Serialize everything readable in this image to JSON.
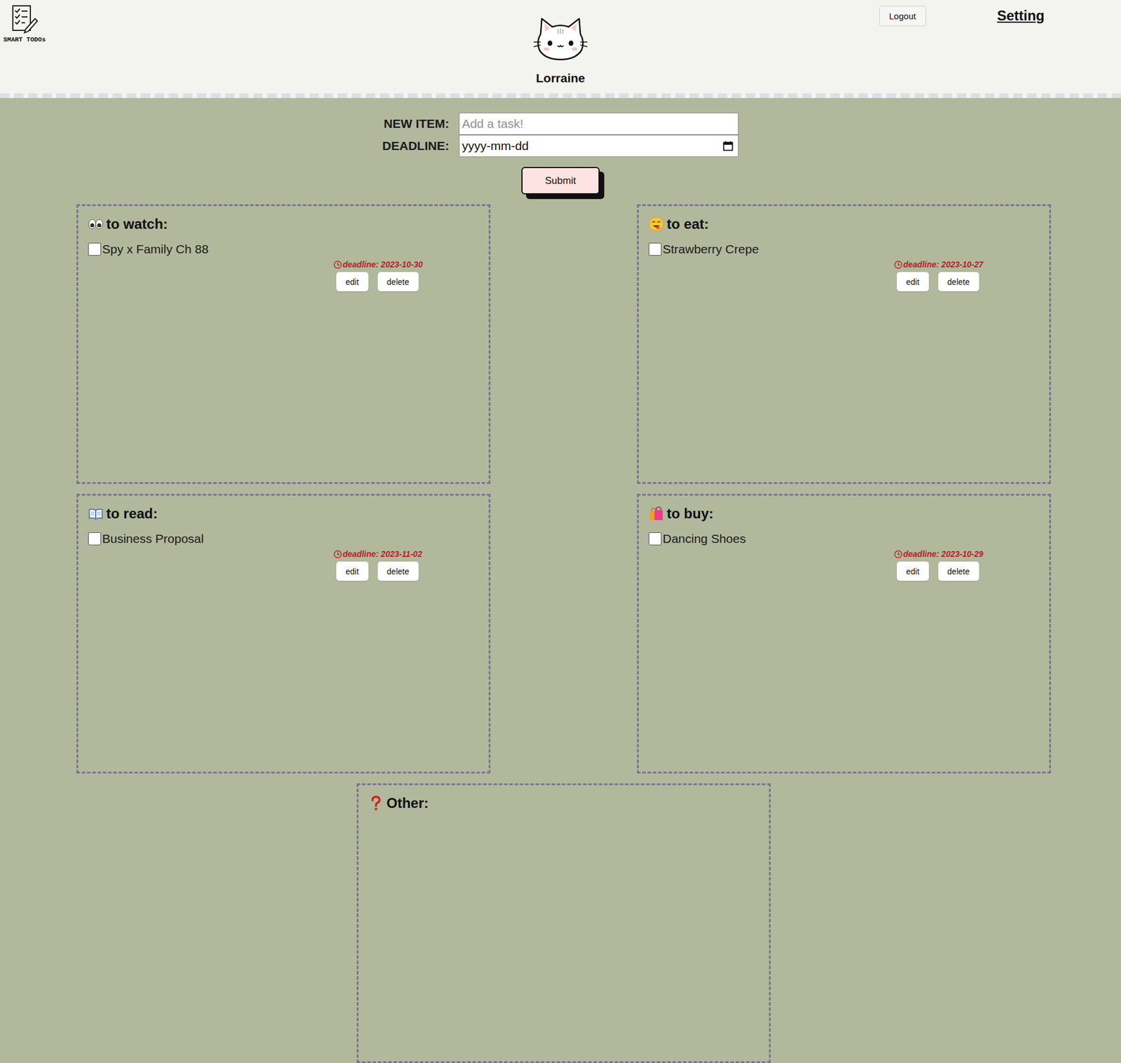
{
  "logo": {
    "text": "SMART TODOs"
  },
  "user": {
    "name": "Lorraine"
  },
  "header": {
    "logout": "Logout",
    "setting": "Setting"
  },
  "form": {
    "item_label": "NEW ITEM:",
    "item_placeholder": "Add a task!",
    "deadline_label": "DEADLINE:",
    "deadline_placeholder": "yyyy-mm-dd",
    "submit": "Submit"
  },
  "lists": [
    {
      "kind": "watch",
      "title": "to watch:",
      "items": [
        {
          "text": "Spy x Family Ch 88",
          "checked": false,
          "deadline": "deadline: 2023-10-30",
          "edit": "edit",
          "delete": "delete"
        }
      ]
    },
    {
      "kind": "eat",
      "title": "to eat:",
      "items": [
        {
          "text": "Strawberry Crepe",
          "checked": false,
          "deadline": "deadline: 2023-10-27",
          "edit": "edit",
          "delete": "delete"
        }
      ]
    },
    {
      "kind": "read",
      "title": "to read:",
      "items": [
        {
          "text": "Business Proposal",
          "checked": false,
          "deadline": "deadline: 2023-11-02",
          "edit": "edit",
          "delete": "delete"
        }
      ]
    },
    {
      "kind": "buy",
      "title": "to buy:",
      "items": [
        {
          "text": "Dancing Shoes",
          "checked": false,
          "deadline": "deadline: 2023-10-29",
          "edit": "edit",
          "delete": "delete"
        }
      ]
    },
    {
      "kind": "other",
      "title": "Other:",
      "items": []
    }
  ]
}
